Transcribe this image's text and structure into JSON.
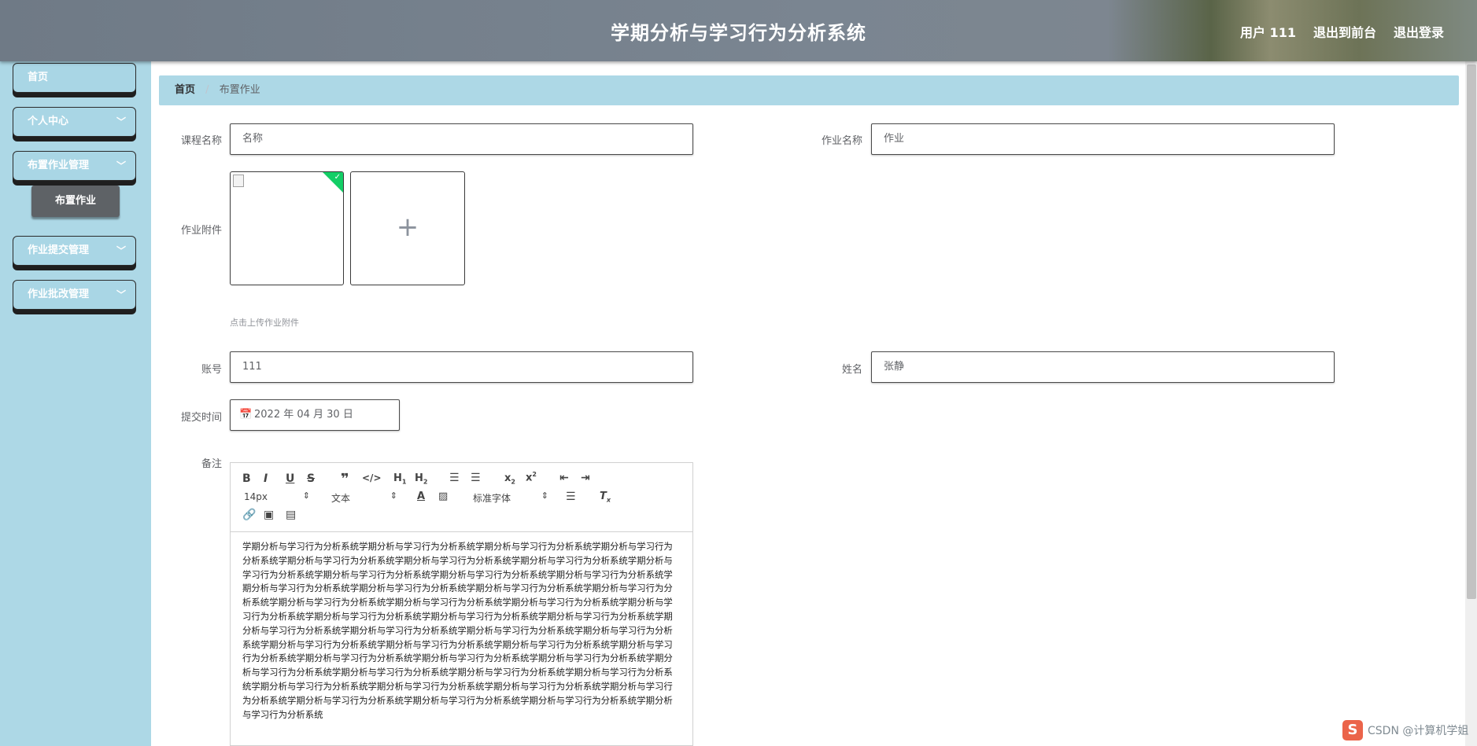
{
  "header": {
    "title": "学期分析与学习行为分析系统",
    "user_label": "用户 111",
    "front_link": "退出到前台",
    "logout_link": "退出登录"
  },
  "sidebar": {
    "items": [
      {
        "label": "首页",
        "has_arrow": false
      },
      {
        "label": "个人中心",
        "has_arrow": true
      },
      {
        "label": "布置作业管理",
        "has_arrow": true
      },
      {
        "label": "作业提交管理",
        "has_arrow": true
      },
      {
        "label": "作业批改管理",
        "has_arrow": true
      }
    ],
    "sub_item": "布置作业"
  },
  "breadcrumb": {
    "home": "首页",
    "separator": "/",
    "current": "布置作业"
  },
  "form": {
    "course_label": "课程名称",
    "course_value": "名称",
    "homework_label": "作业名称",
    "homework_value": "作业",
    "attachment_label": "作业附件",
    "upload_tip": "点击上传作业附件",
    "account_label": "账号",
    "account_value": "111",
    "name_label": "姓名",
    "name_value": "张静",
    "submit_time_label": "提交时间",
    "submit_time_value": "2022 年 04 月 30 日",
    "remark_label": "备注"
  },
  "editor": {
    "font_size": "14px",
    "block_type": "文本",
    "font_family": "标准字体",
    "content": "学期分析与学习行为分析系统学期分析与学习行为分析系统学期分析与学习行为分析系统学期分析与学习行为分析系统学期分析与学习行为分析系统学期分析与学习行为分析系统学期分析与学习行为分析系统学期分析与学习行为分析系统学期分析与学习行为分析系统学期分析与学习行为分析系统学期分析与学习行为分析系统学期分析与学习行为分析系统学期分析与学习行为分析系统学期分析与学习行为分析系统学期分析与学习行为分析系统学期分析与学习行为分析系统学期分析与学习行为分析系统学期分析与学习行为分析系统学期分析与学习行为分析系统学期分析与学习行为分析系统学期分析与学习行为分析系统学期分析与学习行为分析系统学期分析与学习行为分析系统学期分析与学习行为分析系统学期分析与学习行为分析系统学期分析与学习行为分析系统学期分析与学习行为分析系统学期分析与学习行为分析系统学期分析与学习行为分析系统学期分析与学习行为分析系统学期分析与学习行为分析系统学期分析与学习行为分析系统学期分析与学习行为分析系统学期分析与学习行为分析系统学期分析与学习行为分析系统学期分析与学习行为分析系统学期分析与学习行为分析系统学期分析与学习行为分析系统学期分析与学习行为分析系统学期分析与学习行为分析系统学期分析与学习行为分析系统学期分析与学习行为分析系统学期分析与学习行为分析系统学期分析与学习行为分析系统学期分析与学习行为分析系统"
  },
  "watermark": "CSDN @计算机学姐",
  "colors": {
    "sidebar_bg": "#add8e6",
    "breadcrumb_bg": "#add8e6",
    "header_bg": "#7a8591",
    "success": "#13ce66"
  }
}
